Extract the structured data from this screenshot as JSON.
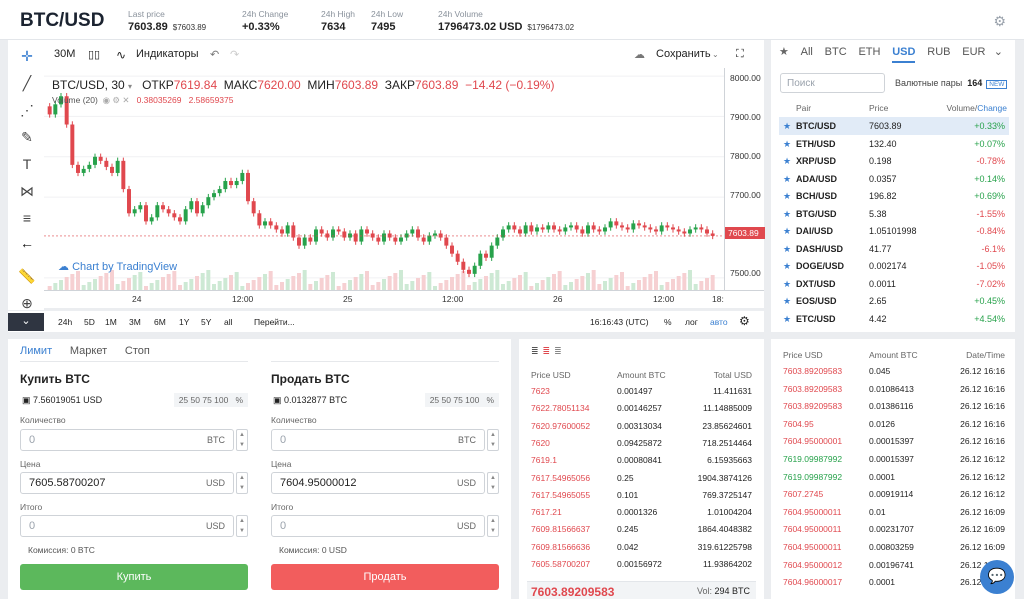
{
  "header": {
    "pair": "BTC/USD",
    "last_price_label": "Last price",
    "last_price": "7603.89",
    "last_price_sub": "$7603.89",
    "change_label": "24h Change",
    "change": "+0.33%",
    "high_label": "24h High",
    "high": "7634",
    "low_label": "24h Low",
    "low": "7495",
    "volume_label": "24h Volume",
    "volume": "1796473.02 USD",
    "volume_sub": "$1796473.02"
  },
  "chart_toolbar": {
    "interval": "30M",
    "indicators": "Индикаторы",
    "save": "Сохранить"
  },
  "chart_legend": {
    "symbol": "BTC/USD, 30",
    "open_label": "ОТКР",
    "open": "7619.84",
    "high_label": "МАКС",
    "high": "7620.00",
    "low_label": "МИН",
    "low": "7603.89",
    "close_label": "ЗАКР",
    "close": "7603.89",
    "change": "−14.42 (−0.19%)",
    "volume_label": "Volume (20)",
    "vol1": "0.38035269",
    "vol2": "2.58659375",
    "tv_credit": "Chart by TradingView",
    "price_tag": "7603.89"
  },
  "chart_bottom": {
    "ranges": [
      "5D",
      "1M",
      "3M",
      "6M",
      "1Y",
      "5Y",
      "all"
    ],
    "range_first": "24h",
    "goto": "Перейти...",
    "time": "16:16:43 (UTC)",
    "pct": "%",
    "log": "лог",
    "auto": "авто"
  },
  "chart_data": {
    "type": "candlestick",
    "y_ticks": [
      "8000.00",
      "7900.00",
      "7800.00",
      "7700.00",
      "7500.00"
    ],
    "x_ticks": [
      "24",
      "12:00",
      "25",
      "12:00",
      "26",
      "12:00",
      "18:"
    ],
    "ylim": [
      7470,
      8020
    ],
    "closes": [
      7905,
      7930,
      7950,
      7880,
      7780,
      7760,
      7770,
      7780,
      7800,
      7790,
      7775,
      7760,
      7790,
      7720,
      7660,
      7670,
      7680,
      7640,
      7650,
      7680,
      7670,
      7660,
      7650,
      7640,
      7670,
      7690,
      7660,
      7680,
      7700,
      7710,
      7720,
      7740,
      7730,
      7740,
      7760,
      7690,
      7660,
      7630,
      7640,
      7630,
      7620,
      7610,
      7630,
      7600,
      7580,
      7600,
      7590,
      7620,
      7610,
      7600,
      7620,
      7615,
      7600,
      7610,
      7590,
      7620,
      7610,
      7600,
      7590,
      7610,
      7600,
      7590,
      7600,
      7610,
      7620,
      7600,
      7590,
      7605,
      7610,
      7600,
      7580,
      7560,
      7540,
      7520,
      7510,
      7530,
      7560,
      7550,
      7580,
      7600,
      7620,
      7630,
      7620,
      7610,
      7630,
      7615,
      7625,
      7620,
      7630,
      7620,
      7615,
      7625,
      7630,
      7620,
      7610,
      7630,
      7620,
      7615,
      7625,
      7640,
      7630,
      7625,
      7620,
      7635,
      7630,
      7625,
      7620,
      7615,
      7630,
      7625,
      7620,
      7615,
      7610,
      7620,
      7625,
      7620,
      7610,
      7604
    ]
  },
  "market": {
    "tabs": [
      "All",
      "BTC",
      "ETH",
      "USD",
      "RUB",
      "EUR"
    ],
    "active_tab": "USD",
    "search_placeholder": "Поиск",
    "pairs_label": "Валютные пары",
    "pairs_count": "164",
    "new_badge": "NEW",
    "head_pair": "Pair",
    "head_price": "Price",
    "head_vol": "Volume/",
    "head_change": "Change",
    "rows": [
      {
        "pair": "BTC/USD",
        "price": "7603.89",
        "change": "+0.33%"
      },
      {
        "pair": "ETH/USD",
        "price": "132.40",
        "change": "+0.07%"
      },
      {
        "pair": "XRP/USD",
        "price": "0.198",
        "change": "-0.78%"
      },
      {
        "pair": "ADA/USD",
        "price": "0.0357",
        "change": "+0.14%"
      },
      {
        "pair": "BCH/USD",
        "price": "196.82",
        "change": "+0.69%"
      },
      {
        "pair": "BTG/USD",
        "price": "5.38",
        "change": "-1.55%"
      },
      {
        "pair": "DAI/USD",
        "price": "1.05101998",
        "change": "-0.84%"
      },
      {
        "pair": "DASH/USD",
        "price": "41.77",
        "change": "-6.1%"
      },
      {
        "pair": "DOGE/USD",
        "price": "0.002174",
        "change": "-1.05%"
      },
      {
        "pair": "DXT/USD",
        "price": "0.0011",
        "change": "-7.02%"
      },
      {
        "pair": "EOS/USD",
        "price": "2.65",
        "change": "+0.45%"
      },
      {
        "pair": "ETC/USD",
        "price": "4.42",
        "change": "+4.54%"
      }
    ]
  },
  "order_form": {
    "tabs": [
      "Лимит",
      "Маркет",
      "Стоп"
    ],
    "buy": {
      "title": "Купить BTC",
      "balance": "7.56019051 USD",
      "pcts": "25  50  75  100",
      "pct_sign": "%",
      "qty_label": "Количество",
      "qty_value": "0",
      "qty_cur": "BTC",
      "price_label": "Цена",
      "price_value": "7605.58700207",
      "price_cur": "USD",
      "total_label": "Итого",
      "total_value": "0",
      "total_cur": "USD",
      "fee": "Комиссия: 0 BTC",
      "button": "Купить"
    },
    "sell": {
      "title": "Продать BTC",
      "balance": "0.0132877 BTC",
      "pcts": "25  50  75  100",
      "pct_sign": "%",
      "qty_label": "Количество",
      "qty_value": "0",
      "qty_cur": "BTC",
      "price_label": "Цена",
      "price_value": "7604.95000012",
      "price_cur": "USD",
      "total_label": "Итого",
      "total_value": "0",
      "total_cur": "USD",
      "fee": "Комиссия: 0 USD",
      "button": "Продать"
    }
  },
  "order_book": {
    "head_price": "Price USD",
    "head_amount": "Amount BTC",
    "head_total": "Total USD",
    "rows": [
      {
        "price": "7623",
        "amount": "0.001497",
        "total": "11.411631"
      },
      {
        "price": "7622.78051134",
        "amount": "0.00146257",
        "total": "11.14885009"
      },
      {
        "price": "7620.97600052",
        "amount": "0.00313034",
        "total": "23.85624601"
      },
      {
        "price": "7620",
        "amount": "0.09425872",
        "total": "718.2514464"
      },
      {
        "price": "7619.1",
        "amount": "0.00080841",
        "total": "6.15935663"
      },
      {
        "price": "7617.54965056",
        "amount": "0.25",
        "total": "1904.3874126"
      },
      {
        "price": "7617.54965055",
        "amount": "0.101",
        "total": "769.3725147"
      },
      {
        "price": "7617.21",
        "amount": "0.0001326",
        "total": "1.01004204"
      },
      {
        "price": "7609.81566637",
        "amount": "0.245",
        "total": "1864.4048382"
      },
      {
        "price": "7609.81566636",
        "amount": "0.042",
        "total": "319.61225798"
      },
      {
        "price": "7605.58700207",
        "amount": "0.00156972",
        "total": "11.93864202"
      }
    ],
    "last_price": "7603.89209583",
    "vol_label": "Vol:",
    "vol": "294 BTC"
  },
  "trades": {
    "head_price": "Price USD",
    "head_amount": "Amount BTC",
    "head_time": "Date/Time",
    "rows": [
      {
        "price": "7603.89209583",
        "amount": "0.045",
        "time": "26.12 16:16",
        "side": "sell"
      },
      {
        "price": "7603.89209583",
        "amount": "0.01086413",
        "time": "26.12 16:16",
        "side": "sell"
      },
      {
        "price": "7603.89209583",
        "amount": "0.01386116",
        "time": "26.12 16:16",
        "side": "sell"
      },
      {
        "price": "7604.95",
        "amount": "0.0126",
        "time": "26.12 16:16",
        "side": "sell"
      },
      {
        "price": "7604.95000001",
        "amount": "0.00015397",
        "time": "26.12 16:16",
        "side": "sell"
      },
      {
        "price": "7619.09987992",
        "amount": "0.00015397",
        "time": "26.12 16:12",
        "side": "buy"
      },
      {
        "price": "7619.09987992",
        "amount": "0.0001",
        "time": "26.12 16:12",
        "side": "buy"
      },
      {
        "price": "7607.2745",
        "amount": "0.00919114",
        "time": "26.12 16:12",
        "side": "sell"
      },
      {
        "price": "7604.95000011",
        "amount": "0.01",
        "time": "26.12 16:09",
        "side": "sell"
      },
      {
        "price": "7604.95000011",
        "amount": "0.00231707",
        "time": "26.12 16:09",
        "side": "sell"
      },
      {
        "price": "7604.95000011",
        "amount": "0.00803259",
        "time": "26.12 16:09",
        "side": "sell"
      },
      {
        "price": "7604.95000012",
        "amount": "0.00196741",
        "time": "26.12 16:09",
        "side": "sell"
      },
      {
        "price": "7604.96000017",
        "amount": "0.0001",
        "time": "26.12 16:09",
        "side": "sell"
      }
    ]
  },
  "colors": {
    "up": "#27a24b",
    "down": "#e0484e",
    "accent": "#3b80d1",
    "buy_btn": "#5cb85c",
    "sell_btn": "#f25d5d"
  }
}
